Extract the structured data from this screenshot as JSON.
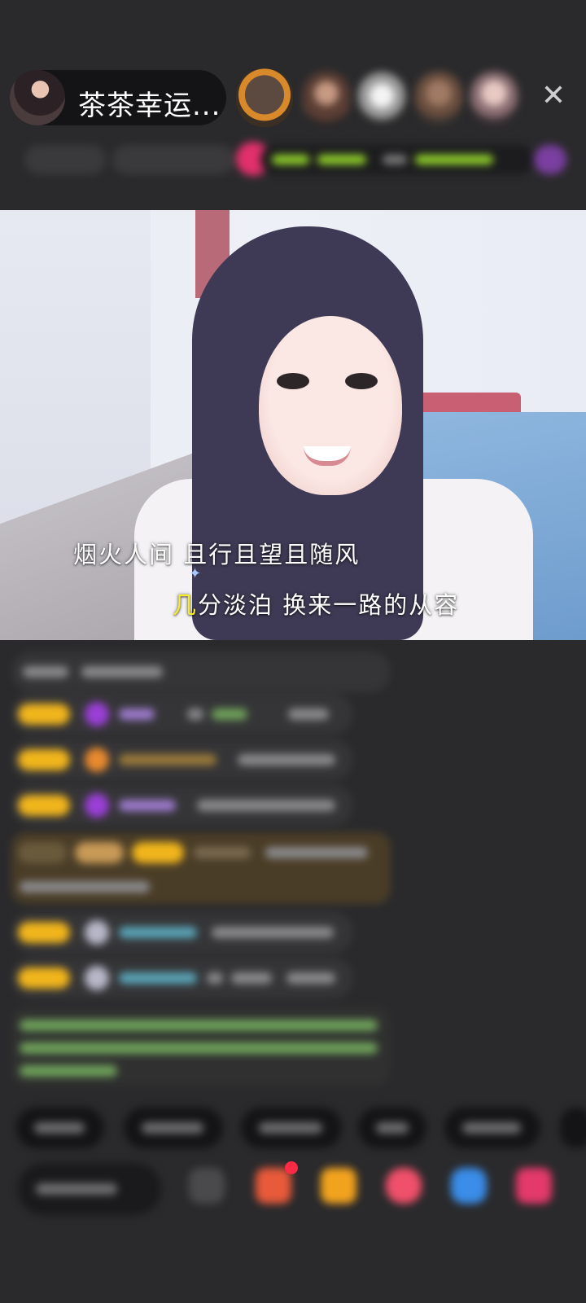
{
  "header": {
    "host_name": "茶茶幸运...",
    "close_icon": "close-icon"
  },
  "video": {
    "lyric_line_1": "烟火人间  且行且望且随风",
    "lyric_line_2_highlight": "几",
    "lyric_line_2_rest": "分淡泊  换来一路的从容"
  },
  "colors": {
    "background": "#2a2a2c",
    "lyric_highlight": "#f6ec2c",
    "level_badge": "#f1b51c"
  }
}
